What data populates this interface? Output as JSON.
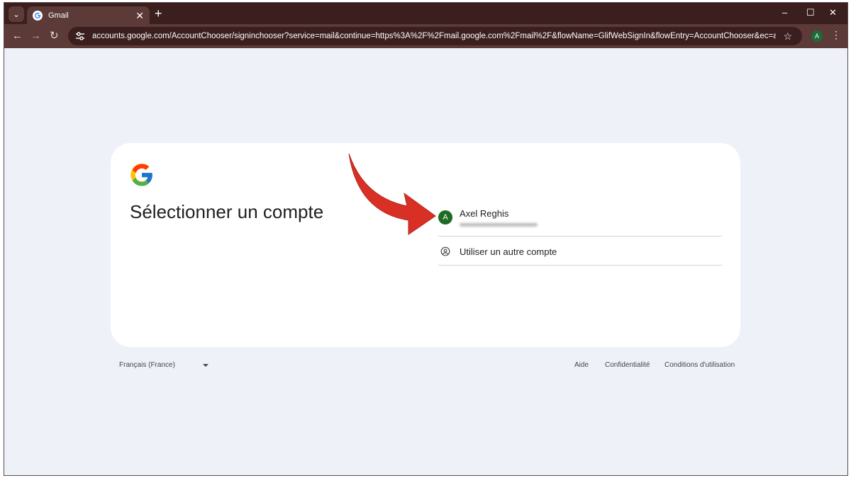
{
  "browser": {
    "tab_title": "Gmail",
    "tab_close": "✕",
    "new_tab": "+",
    "url": "accounts.google.com/AccountChooser/signinchooser?service=mail&continue=https%3A%2F%2Fmail.google.com%2Fmail%2F&flowName=GlifWebSignIn&flowEntry=AccountChooser&ec=asw-gmail-globaln...",
    "profile_initial": "A",
    "window_controls": {
      "minimize": "–",
      "maximize": "☐",
      "close": "✕"
    },
    "nav": {
      "back": "←",
      "forward": "→",
      "reload": "↻"
    },
    "accent_color": "#5b3a37"
  },
  "page": {
    "heading": "Sélectionner un compte",
    "account": {
      "initial": "A",
      "name": "Axel Reghis"
    },
    "other_account_label": "Utiliser un autre compte"
  },
  "footer": {
    "language": "Français (France)",
    "links": [
      "Aide",
      "Confidentialité",
      "Conditions d'utilisation"
    ]
  },
  "icons": [
    "chevron-down-icon",
    "google-g-icon",
    "star-icon",
    "account-circle-icon",
    "red-arrow-annotation"
  ]
}
